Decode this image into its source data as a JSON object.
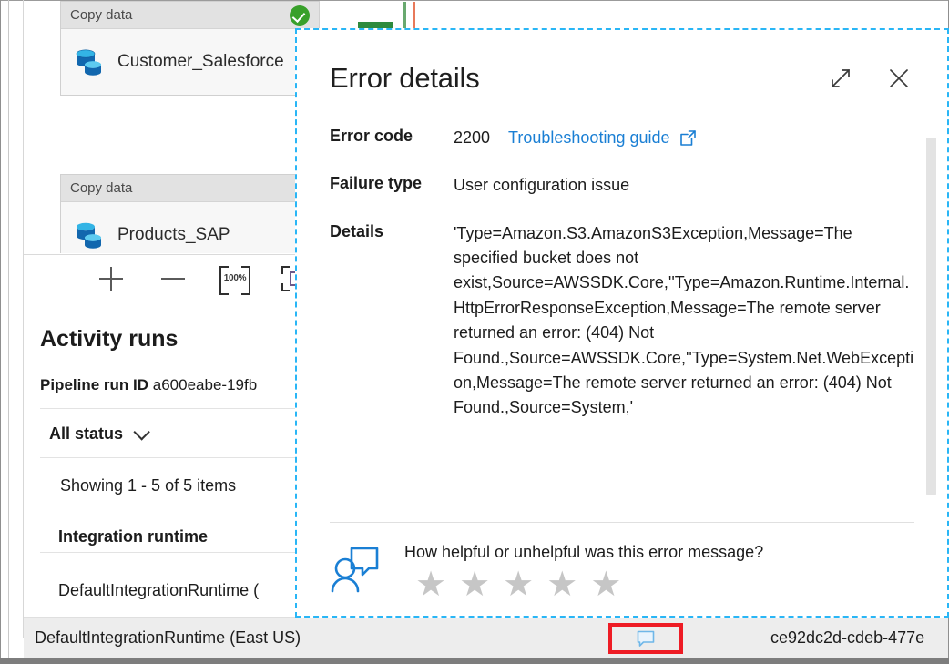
{
  "canvas": {
    "nodes": [
      {
        "header": "Copy data",
        "label": "Customer_Salesforce",
        "status_icon": "check-circle-icon"
      },
      {
        "header": "Copy data",
        "label": "Products_SAP",
        "status_icon": "none"
      }
    ]
  },
  "zoom_toolbar": {
    "zoom_in": "+",
    "zoom_out": "−",
    "zoom_level": "100%",
    "fit_to_screen": "fit-to-screen-icon"
  },
  "activity": {
    "title": "Activity runs",
    "pipeline_run_id_label": "Pipeline run ID",
    "pipeline_run_id_value": "a600eabe-19fb",
    "status_filter": "All status",
    "showing": "Showing 1 - 5 of 5 items",
    "column_header": "Integration runtime",
    "row_1": "DefaultIntegrationRuntime (",
    "selected_row": {
      "integration_runtime": "DefaultIntegrationRuntime (East US)",
      "comment_icon": "comment-bubble-icon",
      "run_id": "ce92dc2d-cdeb-477e"
    }
  },
  "dialog": {
    "title": "Error details",
    "expand_icon": "expand-diagonal-icon",
    "close_icon": "close-icon",
    "fields": [
      {
        "label": "Error code",
        "value": "2200"
      },
      {
        "label": "Failure type",
        "value": "User configuration issue"
      },
      {
        "label": "Details",
        "value": "'Type=Amazon.S3.AmazonS3Exception,Message=The specified bucket does not exist,Source=AWSSDK.Core,''Type=Amazon.Runtime.Internal.HttpErrorResponseException,Message=The remote server returned an error: (404) Not Found.,Source=AWSSDK.Core,''Type=System.Net.WebException,Message=The remote server returned an error: (404) Not Found.,Source=System,'"
      }
    ],
    "troubleshooting_link": "Troubleshooting guide",
    "external_link_icon": "external-link-icon",
    "feedback": {
      "icon": "feedback-person-icon",
      "question": "How helpful or unhelpful was this error message?",
      "stars": [
        "★",
        "★",
        "★",
        "★",
        "★"
      ]
    }
  },
  "colors": {
    "link": "#1a7fd4",
    "dialog_border": "#29b6f6",
    "highlight_box": "#ee1c25",
    "success": "#38a02a",
    "star_empty": "#c6c6c6"
  }
}
